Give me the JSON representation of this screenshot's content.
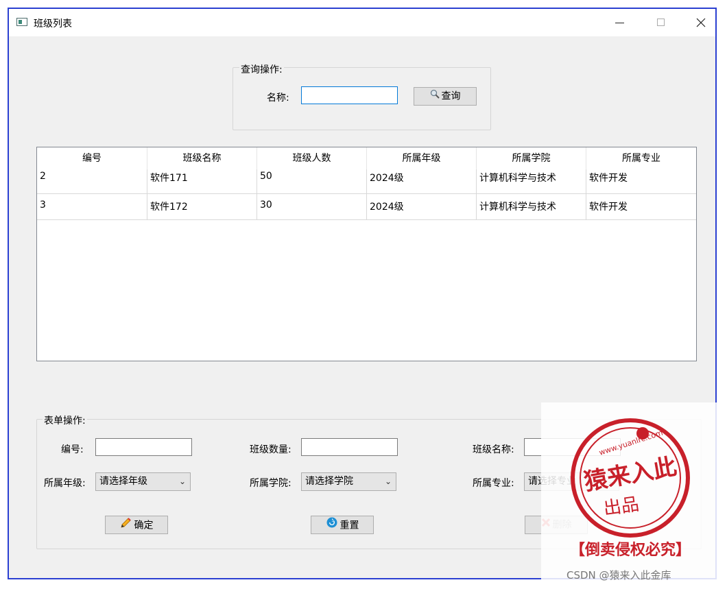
{
  "window": {
    "title": "班级列表"
  },
  "query": {
    "group_label": "查询操作:",
    "name_label": "名称:",
    "name_value": "",
    "search_button": "查询"
  },
  "grid": {
    "columns": [
      "编号",
      "班级名称",
      "班级人数",
      "所属年级",
      "所属学院",
      "所属专业"
    ],
    "rows": [
      [
        "2",
        "软件171",
        "50",
        "2024级",
        "计算机科学与技术",
        "软件开发"
      ],
      [
        "3",
        "软件172",
        "30",
        "2024级",
        "计算机科学与技术",
        "软件开发"
      ]
    ]
  },
  "form": {
    "group_label": "表单操作:",
    "id_label": "编号:",
    "id_value": "",
    "count_label": "班级数量:",
    "count_value": "",
    "classname_label": "班级名称:",
    "classname_value": "",
    "grade_label": "所属年级:",
    "grade_selected": "请选择年级",
    "college_label": "所属学院:",
    "college_selected": "请选择学院",
    "major_label": "所属专业:",
    "major_selected": "请选择专业",
    "confirm_button": "确定",
    "reset_button": "重置",
    "delete_button": "删除"
  },
  "watermark": {
    "url": "www.yuanlrc.com",
    "main": "猿来入此",
    "sub": "出品",
    "warning": "【倒卖侵权必究】",
    "credit": "CSDN @猿来入此金库"
  },
  "colors": {
    "window_border": "#2a3fd1",
    "focus_blue": "#0078d7",
    "stamp_red": "#c8202a"
  }
}
